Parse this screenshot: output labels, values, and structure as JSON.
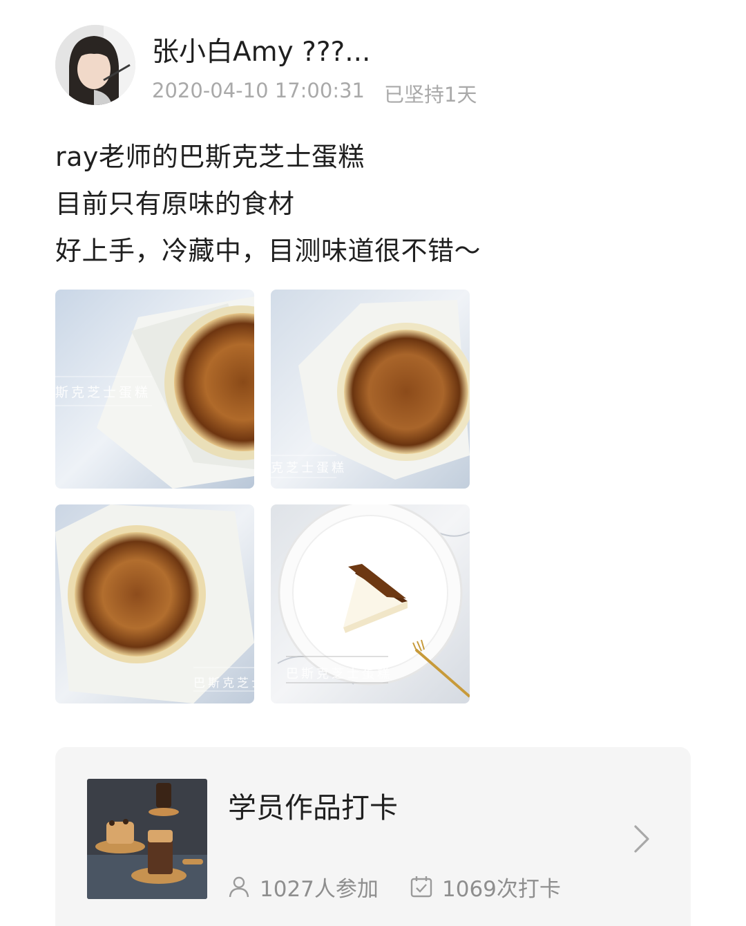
{
  "author": {
    "name": "张小白Amy ???...",
    "timestamp": "2020-04-10 17:00:31",
    "streak": "已坚持1天"
  },
  "post": {
    "lines": [
      "ray老师的巴斯克芝士蛋糕",
      "目前只有原味的食材",
      "好上手，冷藏中，目测味道很不错～"
    ],
    "photos": [
      {
        "caption": "斯克芝士蛋糕"
      },
      {
        "caption": "克芝士蛋糕"
      },
      {
        "caption": "巴斯克芝士"
      },
      {
        "caption": "巴斯克芝士蛋糕"
      }
    ]
  },
  "challenge_card": {
    "title": "学员作品打卡",
    "participants": "1027人参加",
    "checkins": "1069次打卡",
    "icons": [
      "user-icon",
      "calendar-check-icon",
      "chevron-right-icon"
    ]
  },
  "colors": {
    "text_primary": "#1f1f1f",
    "text_secondary": "#a9a9a9",
    "stat_text": "#8e8e8e",
    "card_background": "#f5f5f5",
    "cake_top": "#7a3d12"
  }
}
